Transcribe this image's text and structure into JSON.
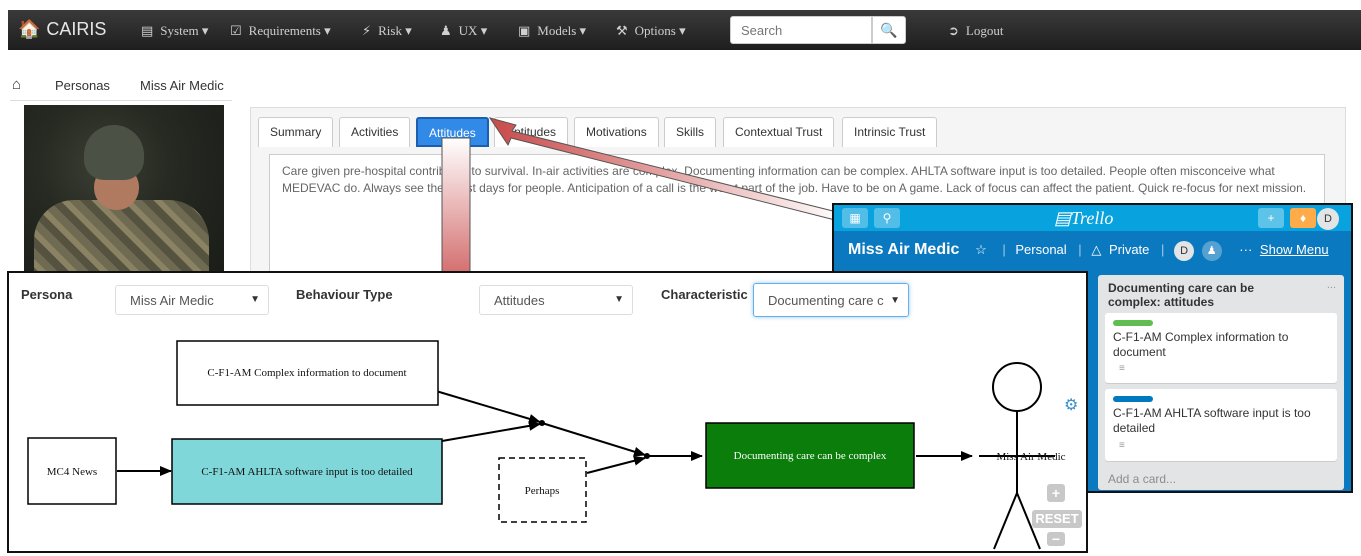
{
  "navbar": {
    "brand": "CAIRIS",
    "items": [
      {
        "label": "System",
        "icon": "file-icon"
      },
      {
        "label": "Requirements",
        "icon": "check-square-icon"
      },
      {
        "label": "Risk",
        "icon": "bolt-icon"
      },
      {
        "label": "UX",
        "icon": "user-icon"
      },
      {
        "label": "Models",
        "icon": "picture-icon"
      },
      {
        "label": "Options",
        "icon": "wrench-icon"
      }
    ],
    "search_placeholder": "Search",
    "logout": "Logout"
  },
  "breadcrumb": {
    "section": "Personas",
    "current": "Miss Air Medic"
  },
  "persona_tabs": [
    "Summary",
    "Activities",
    "Attitudes",
    "Aptitudes",
    "Motivations",
    "Skills",
    "Contextual Trust",
    "Intrinsic Trust"
  ],
  "active_tab": "Attitudes",
  "attitudes_text": "Care given pre-hospital contributes to survival. In-air activities are complex. Documenting information can be complex. AHLTA software input is too detailed. People often misconceive what MEDEVAC do. Always see the worst days for people. Anticipation of a call is the worst part of the job. Have to be on A game. Lack of focus can affect the patient. Quick re-focus for next mission.",
  "trello": {
    "logo": "Trello",
    "board_title": "Miss Air Medic",
    "team": "Personal",
    "visibility": "Private",
    "member_initial": "D",
    "show_menu": "Show Menu",
    "list_title": "Documenting care can be complex: attitudes",
    "list_menu": "...",
    "cards": [
      {
        "text": "C-F1-AM Complex information to document",
        "label_color": "#61bd4f"
      },
      {
        "text": "C-F1-AM AHLTA software input is too detailed",
        "label_color": "#0079bf"
      }
    ],
    "add_card": "Add a card..."
  },
  "model": {
    "persona_label": "Persona",
    "persona_value": "Miss Air Medic",
    "behaviour_label": "Behaviour Type",
    "behaviour_value": "Attitudes",
    "characteristic_label": "Characteristic",
    "characteristic_value": "Documenting care can be complex",
    "nodes": {
      "complex_info": "C-F1-AM Complex information to document",
      "mc4": "MC4 News",
      "ahlta": "C-F1-AM AHLTA software input is too detailed",
      "perhaps": "Perhaps",
      "characteristic": "Documenting care can be complex",
      "persona": "Miss Air Medic"
    },
    "reset": "RESET",
    "colors": {
      "ahlta_fill": "#7fd7d9",
      "characteristic_fill": "#0b7d0b"
    }
  }
}
